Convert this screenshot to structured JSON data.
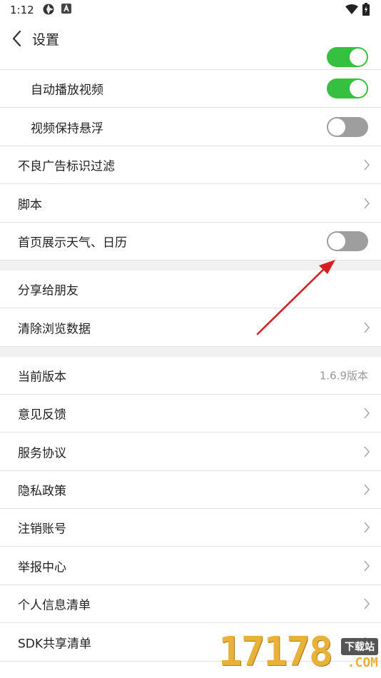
{
  "status_bar": {
    "time": "1:12"
  },
  "header": {
    "title": "设置"
  },
  "settings": {
    "autoplay_video": {
      "label": "自动播放视频",
      "enabled": true
    },
    "video_float": {
      "label": "视频保持悬浮",
      "enabled": false
    },
    "ad_filter": {
      "label": "不良广告标识过滤"
    },
    "script": {
      "label": "脚本"
    },
    "weather_calendar": {
      "label": "首页展示天气、日历",
      "enabled": false
    },
    "share": {
      "label": "分享给朋友"
    },
    "clear_data": {
      "label": "清除浏览数据"
    },
    "version": {
      "label": "当前版本",
      "value": "1.6.9版本"
    },
    "feedback": {
      "label": "意见反馈"
    },
    "service_agreement": {
      "label": "服务协议"
    },
    "privacy_policy": {
      "label": "隐私政策"
    },
    "cancel_account": {
      "label": "注销账号"
    },
    "report_center": {
      "label": "举报中心"
    },
    "personal_info_list": {
      "label": "个人信息清单"
    },
    "sdk_share_list": {
      "label": "SDK共享清单"
    }
  },
  "colors": {
    "toggle_on": "#36c040",
    "toggle_off": "#9e9e9e",
    "annotation_arrow": "#d42020"
  },
  "watermark": {
    "digits": "17178",
    "tag": "下载站",
    "domain": ".COM"
  }
}
